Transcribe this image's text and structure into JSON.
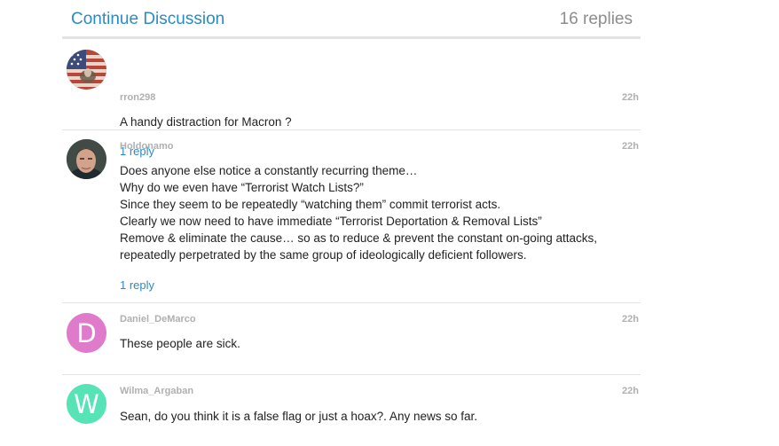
{
  "header": {
    "title": "Continue Discussion",
    "replies": "16 replies"
  },
  "comments": [
    {
      "username": "rron298",
      "time": "22h",
      "lines": [
        "A handy distraction for Macron ?"
      ],
      "reply_link": "1 reply",
      "avatar": "flag-avatar"
    },
    {
      "username": "Holdonamo",
      "time": "22h",
      "lines": [
        "Does anyone else notice a constantly recurring theme…",
        "Why do we even have “Terrorist Watch Lists?”",
        "Since they seem to be repeatedly “watching them” commit terrorist acts.",
        "Clearly we now need to have immediate “Terrorist Deportation & Removal Lists”",
        "Remove & eliminate the cause… so as to reduce & prevent the constant on-going attacks,",
        "repeatedly perpetrated by the same group of ideologically deficient followers."
      ],
      "reply_link": "1 reply",
      "avatar": "photo-avatar"
    },
    {
      "username": "Daniel_DeMarco",
      "time": "22h",
      "lines": [
        "These people are sick."
      ],
      "avatar_letter": "D",
      "avatar_color": "#e07bcb"
    },
    {
      "username": "Wilma_Argaban",
      "time": "22h",
      "lines": [
        "Sean, do you think it is a false flag or just a hoax?. Any news so far."
      ],
      "avatar_letter": "W",
      "avatar_color": "#56e3b6"
    }
  ]
}
